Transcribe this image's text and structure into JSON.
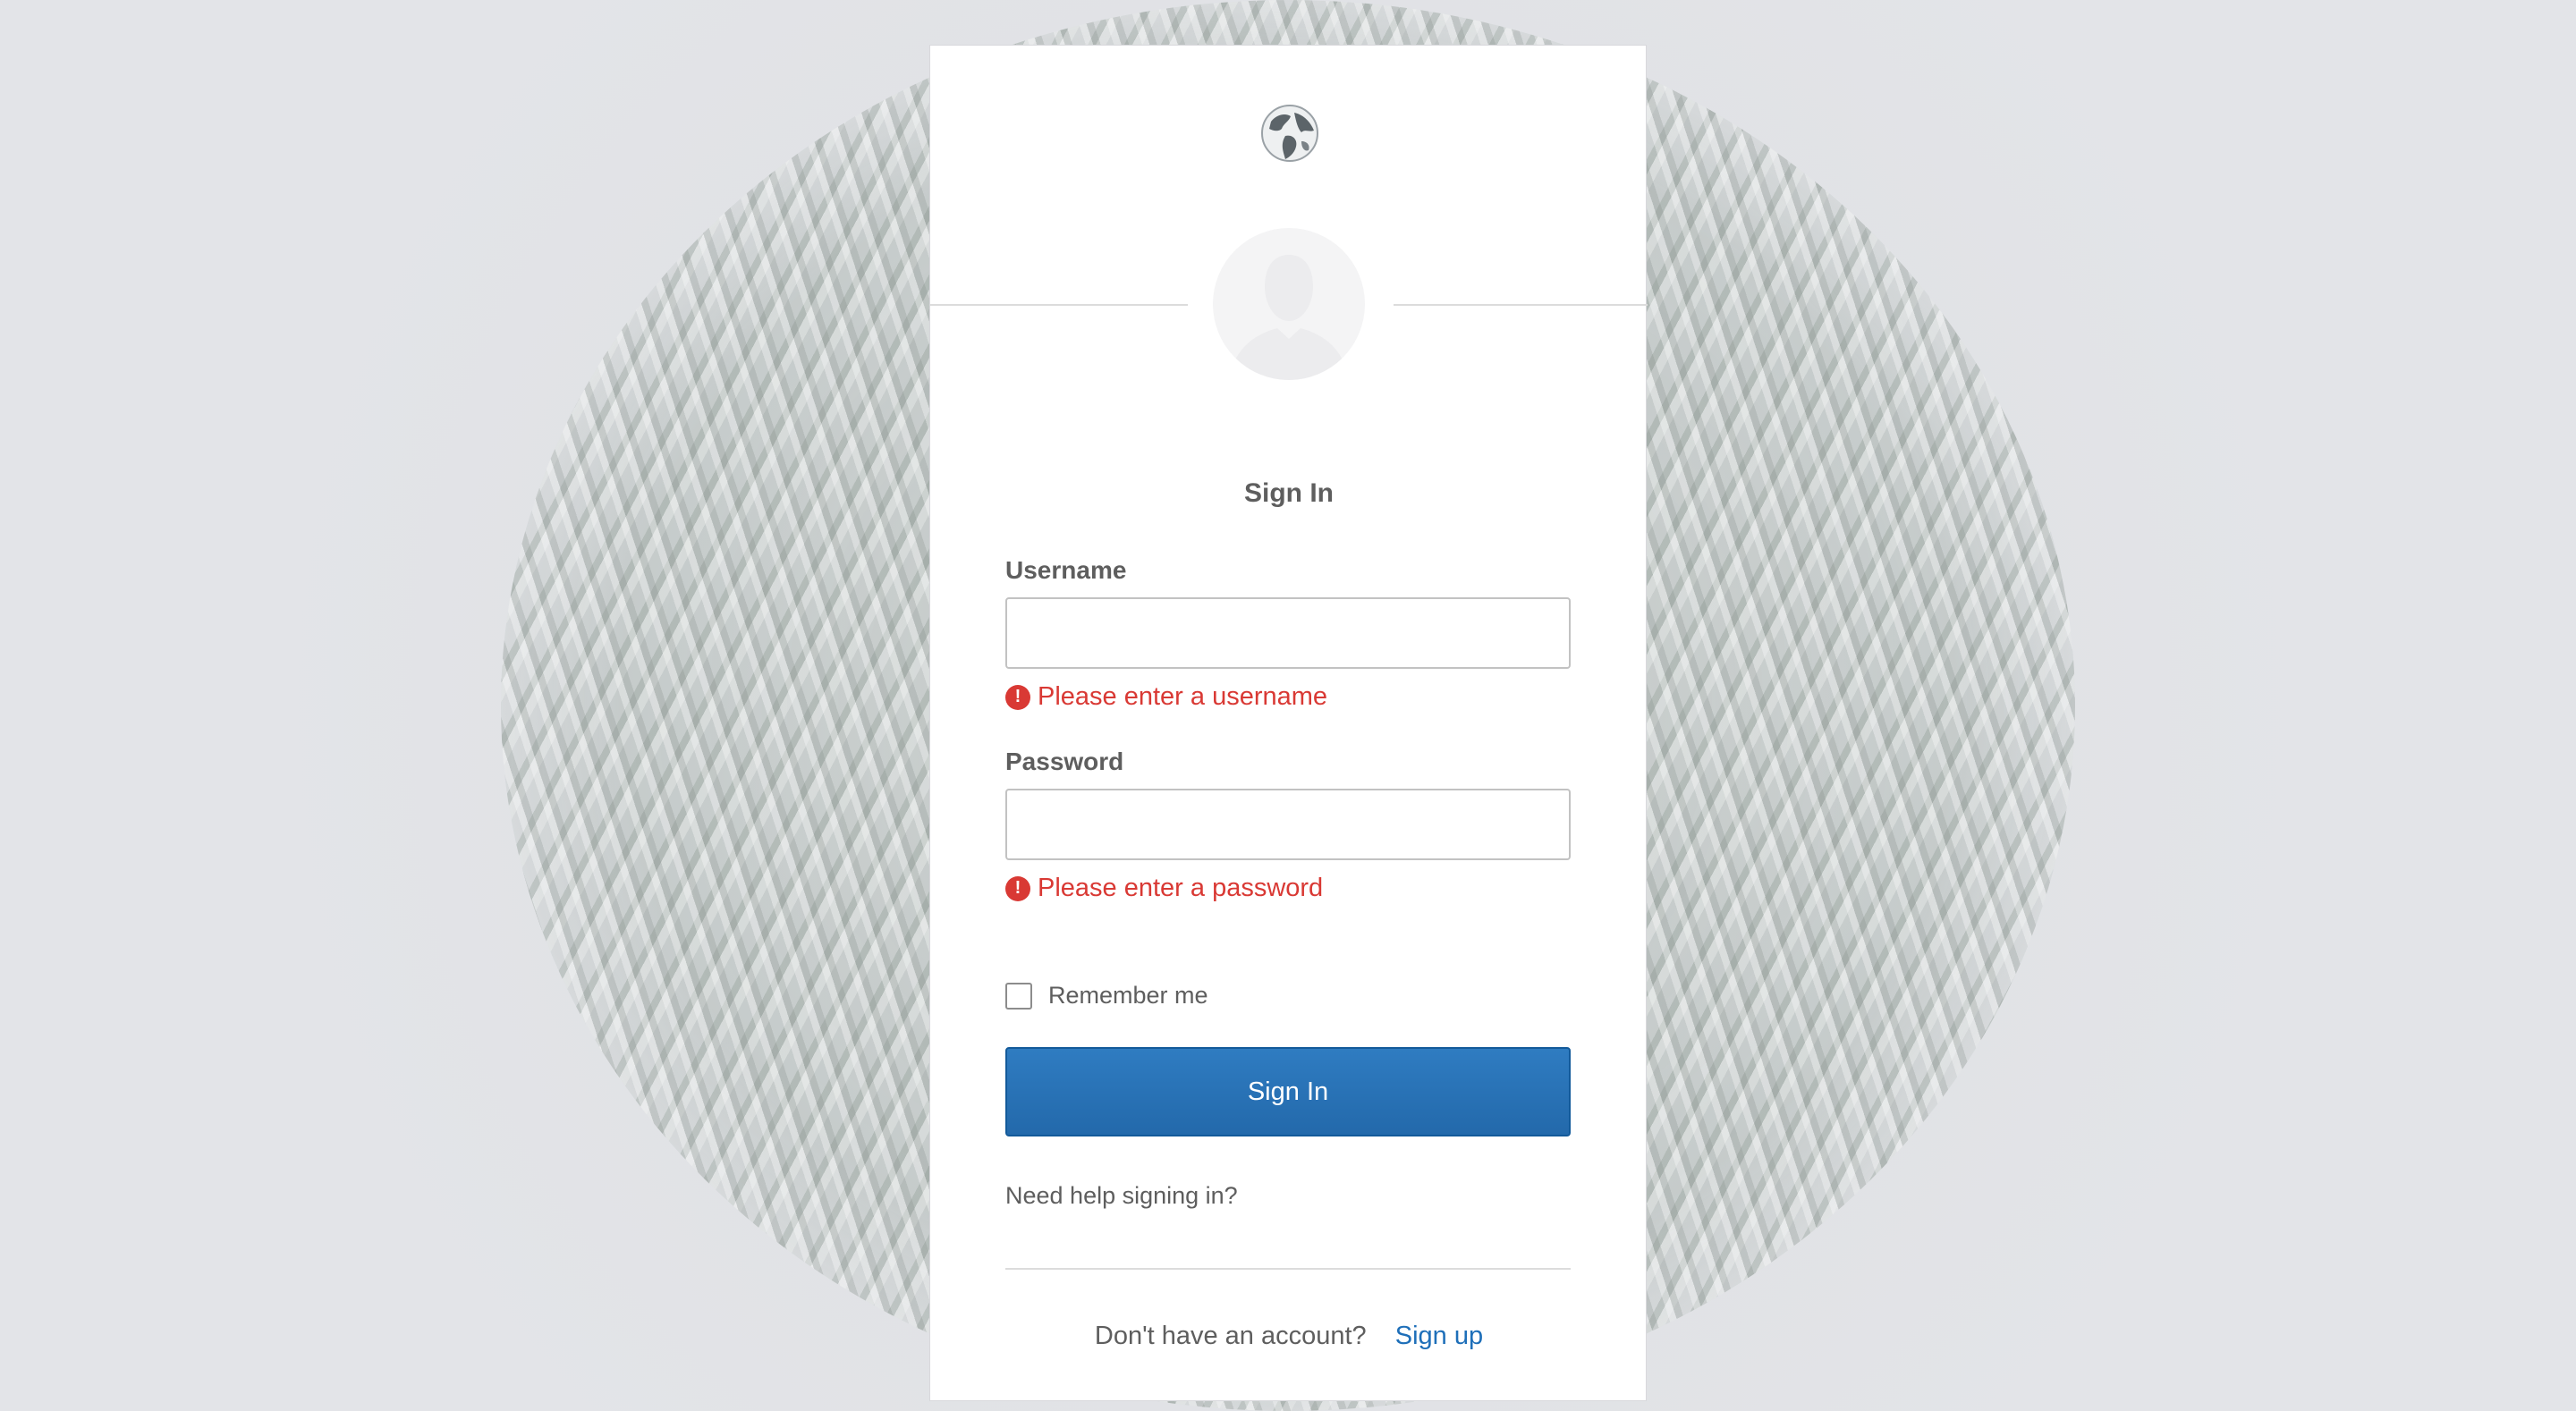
{
  "colors": {
    "primary_button": "#2f7cc1",
    "error": "#d93934",
    "link": "#1e6fb9",
    "text": "#5e5e5e"
  },
  "header": {
    "logo_icon": "globe-icon",
    "avatar_icon": "user-silhouette-icon"
  },
  "form": {
    "title": "Sign In",
    "username": {
      "label": "Username",
      "value": "",
      "error": "Please enter a username"
    },
    "password": {
      "label": "Password",
      "value": "",
      "error": "Please enter a password"
    },
    "error_icon_glyph": "!",
    "remember_me": {
      "label": "Remember me",
      "checked": false
    },
    "submit_label": "Sign In",
    "help_link": "Need help signing in?"
  },
  "footer": {
    "no_account_text": "Don't have an account?",
    "signup_link": "Sign up"
  }
}
